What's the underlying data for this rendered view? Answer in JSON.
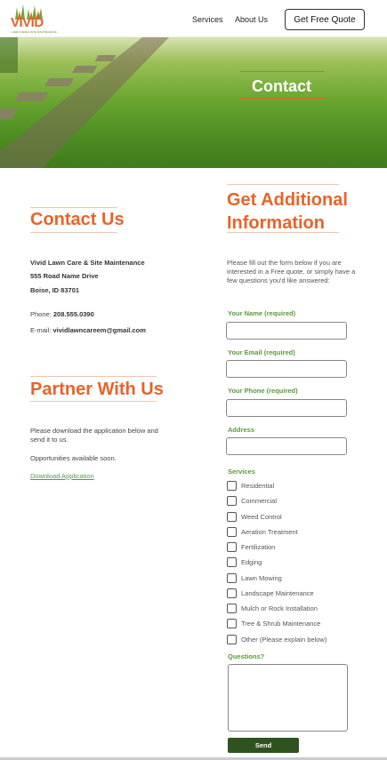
{
  "header": {
    "logo_text": "VIVID",
    "logo_tagline": "LAWN CARE & SITE MAINTENANCE",
    "nav": [
      {
        "label": "Services"
      },
      {
        "label": "About Us"
      }
    ],
    "cta_label": "Get Free Quote"
  },
  "hero": {
    "title": "Contact"
  },
  "contact": {
    "title": "Contact Us",
    "company": "Vivid Lawn Care & Site Maintenance",
    "address_line1": "555 Road Name Drive",
    "address_line2": "Boise, ID 83701",
    "phone_label": "Phone:",
    "phone": "208.555.0390",
    "email_label": "E-mail:",
    "email": "vividlawncareem@gmail.com"
  },
  "partner": {
    "title": "Partner With Us",
    "text1": "Please download the application below and send it to us.",
    "text2": "Opportunities available soon.",
    "link": "Download Application"
  },
  "form": {
    "title": "Get Additional Information",
    "intro": "Please fill out the form below if you are interested in a Free quote, or simply have a few questions you'd like answered:",
    "name_label": "Your Name (required)",
    "email_label": "Your Email (required)",
    "phone_label": "Your Phone (required)",
    "address_label": "Address",
    "services_label": "Services",
    "services": [
      "Residential",
      "Commercial",
      "Weed Control",
      "Aeration Treatment",
      "Fertilization",
      "Edging",
      "Lawn Mowing",
      "Landscape Maintenance",
      "Mulch or Rock Installation",
      "Tree & Shrub Maintenance",
      "Other (Please explain below)"
    ],
    "questions_label": "Questions?",
    "send_label": "Send"
  },
  "colors": {
    "accent": "#e9632a",
    "green": "#5a9a3a",
    "button_dark_green": "#2f5320"
  }
}
